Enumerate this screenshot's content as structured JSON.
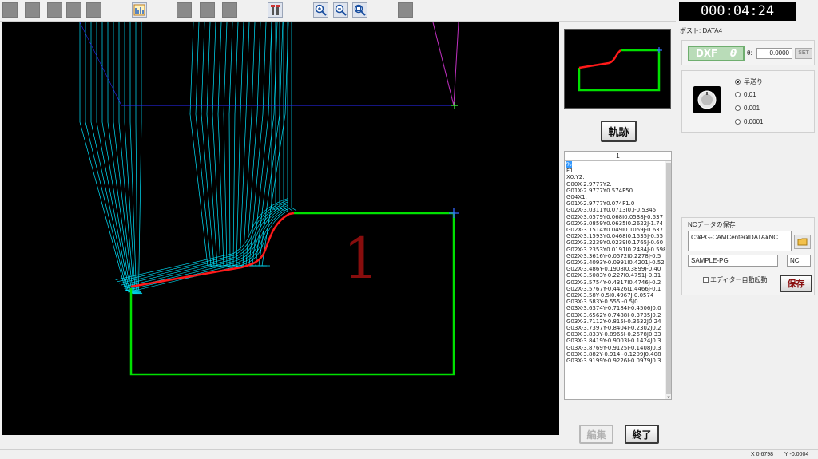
{
  "toolbar": {
    "buttons": [
      "btn",
      "btn",
      "btn",
      "btn",
      "btn",
      "view-icon",
      "btn",
      "btn",
      "tool-icon",
      "zoom-in-icon",
      "zoom-out-icon",
      "zoom-fit-icon",
      "btn"
    ]
  },
  "canvas": {
    "part_label": "1",
    "colors": {
      "background": "#000000",
      "toolpath": "#00e5ff",
      "contour": "#00e000",
      "cut": "#ff1a1a",
      "rapid": "#3333ff"
    }
  },
  "thumbnail": {
    "colors": {
      "contour": "#00e000",
      "cut": "#ff1a1a"
    }
  },
  "buttons": {
    "trace": "軌跡",
    "edit": "編集",
    "end": "終了",
    "save": "保存"
  },
  "nc_list": {
    "header": "1",
    "lines": [
      "%",
      "F1",
      "X0.Y2.",
      "G00X-2.9777Y2.",
      "G01X-2.9777Y0.574F50",
      "G04X1.",
      "G01X-2.9777Y0.074F1.0",
      "G02X-3.0311Y0.0713I0.J-0.5345",
      "G02X-3.0579Y0.068I0.0538J-0.537",
      "G02X-3.0859Y0.0635I0.2622J-1.74",
      "G02X-3.1514Y0.049I0.1059J-0.637",
      "G02X-3.1593Y0.0468I0.1535J-0.55",
      "G02X-3.2239Y0.0239I0.1765J-0.60",
      "G02X-3.2353Y0.0191I0.2484J-0.598",
      "G02X-3.3616Y-0.0572I0.2278J-0.5",
      "G02X-3.4093Y-0.0991I0.4201J-0.52",
      "G02X-3.486Y-0.1908I0.3899J-0.40",
      "G02X-3.5083Y-0.227I0.4751J-0.31",
      "G02X-3.5754Y-0.4317I0.4746J-0.2",
      "G02X-3.5767Y-0.4426I1.4466J-0.1",
      "G02X-3.58Y-0.5I0.4967J-0.0574",
      "G03X-3.583Y-0.555I-0.5J0.",
      "G03X-3.6374Y-0.7184I-0.4506J0.0",
      "G03X-3.6562Y-0.7488I-0.3735J0.2",
      "G03X-3.7112Y-0.815I-0.3632J0.24",
      "G03X-3.7397Y-0.8404I-0.2302J0.2",
      "G03X-3.833Y-0.8965I-0.2678J0.33",
      "G03X-3.8419Y-0.9003I-0.1424J0.3",
      "G03X-3.8769Y-0.9125I-0.1408J0.3",
      "G03X-3.882Y-0.914I-0.1209J0.408",
      "G03X-3.9199Y-0.9226I-0.0979J0.3"
    ]
  },
  "right_panel": {
    "timer": "000:04:24",
    "post_label": "ポスト: DATA4",
    "dxf_label": "DXF",
    "dxf_theta": "θ",
    "theta_label": "θ:",
    "theta_value": "0.0000",
    "set_label": "SET",
    "jog": {
      "options": [
        "早送り",
        "0.01",
        "0.001",
        "0.0001"
      ],
      "selected": "早送り"
    },
    "save": {
      "title": "NCデータの保存",
      "path": "C:¥PG-CAMCenter¥DATA¥NC",
      "name": "SAMPLE-PG",
      "dot": ".",
      "ext": "NC",
      "auto_open_label": "エディター自動起動"
    }
  },
  "status": {
    "x_label": "X  0.6798",
    "y_label": "Y  -0.0004"
  }
}
